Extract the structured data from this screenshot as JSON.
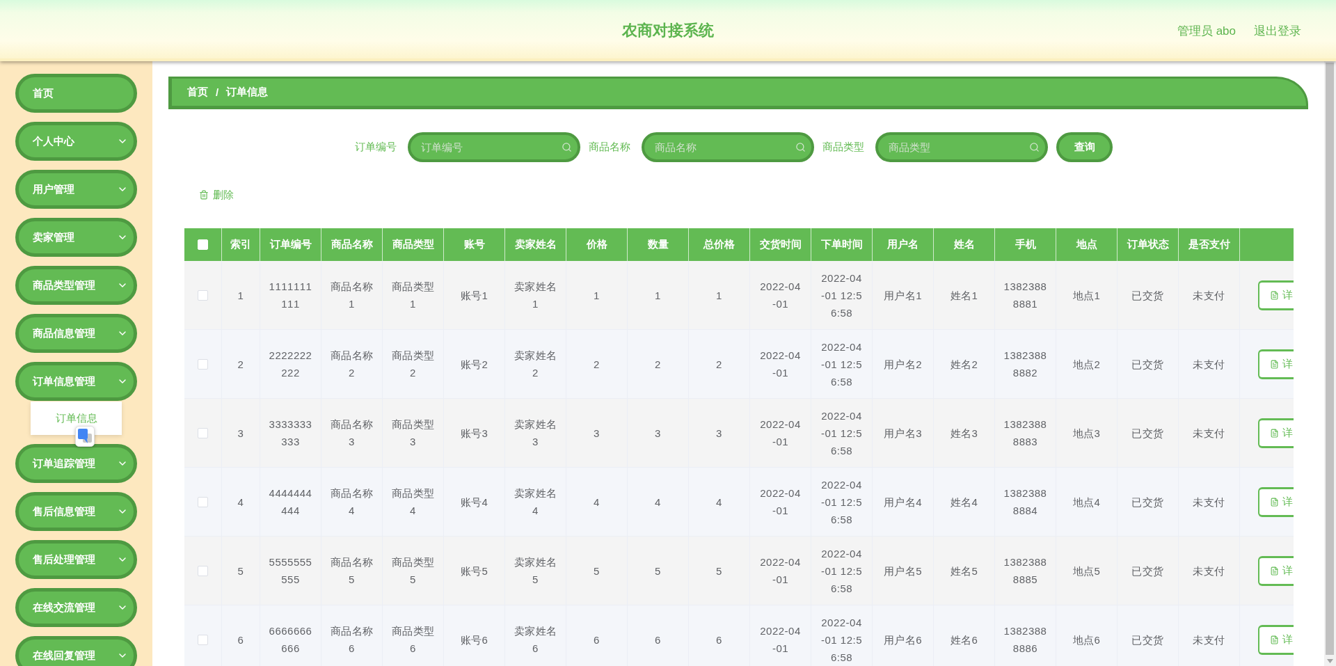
{
  "header": {
    "title": "农商对接系统",
    "user": "管理员 abo",
    "logout": "退出登录"
  },
  "sidebar": {
    "items": [
      {
        "label": "首页",
        "kind": "link"
      },
      {
        "label": "个人中心",
        "kind": "submenu"
      },
      {
        "label": "用户管理",
        "kind": "submenu"
      },
      {
        "label": "卖家管理",
        "kind": "submenu"
      },
      {
        "label": "商品类型管理",
        "kind": "submenu"
      },
      {
        "label": "商品信息管理",
        "kind": "submenu"
      },
      {
        "label": "订单信息管理",
        "kind": "submenu",
        "children": [
          {
            "label": "订单信息"
          }
        ]
      },
      {
        "label": "订单追踪管理",
        "kind": "submenu"
      },
      {
        "label": "售后信息管理",
        "kind": "submenu"
      },
      {
        "label": "售后处理管理",
        "kind": "submenu"
      },
      {
        "label": "在线交流管理",
        "kind": "submenu"
      },
      {
        "label": "在线回复管理",
        "kind": "submenu"
      }
    ]
  },
  "breadcrumb": {
    "items": [
      "首页",
      "订单信息"
    ],
    "separator": "/"
  },
  "search": {
    "fields": [
      {
        "label": "订单编号",
        "placeholder": "订单编号"
      },
      {
        "label": "商品名称",
        "placeholder": "商品名称"
      },
      {
        "label": "商品类型",
        "placeholder": "商品类型"
      }
    ],
    "button": "查询"
  },
  "toolbar": {
    "delete": "删除"
  },
  "table": {
    "select_all": {
      "checked": false
    },
    "columns": [
      "索引",
      "订单编号",
      "商品名称",
      "商品类型",
      "账号",
      "卖家姓名",
      "价格",
      "数量",
      "总价格",
      "交货时间",
      "下单时间",
      "用户名",
      "姓名",
      "手机",
      "地点",
      "订单状态",
      "是否支付"
    ],
    "rows": [
      {
        "checked": false,
        "cells": [
          "1",
          "1111111111",
          "商品名称1",
          "商品类型1",
          "账号1",
          "卖家姓名1",
          "1",
          "1",
          "1",
          "2022-04-01",
          "2022-04-01 12:56:58",
          "用户名1",
          "姓名1",
          "13823888881",
          "地点1",
          "已交货",
          "未支付"
        ],
        "action": "详"
      },
      {
        "checked": false,
        "cells": [
          "2",
          "2222222222",
          "商品名称2",
          "商品类型2",
          "账号2",
          "卖家姓名2",
          "2",
          "2",
          "2",
          "2022-04-01",
          "2022-04-01 12:56:58",
          "用户名2",
          "姓名2",
          "13823888882",
          "地点2",
          "已交货",
          "未支付"
        ],
        "action": "详"
      },
      {
        "checked": false,
        "cells": [
          "3",
          "3333333333",
          "商品名称3",
          "商品类型3",
          "账号3",
          "卖家姓名3",
          "3",
          "3",
          "3",
          "2022-04-01",
          "2022-04-01 12:56:58",
          "用户名3",
          "姓名3",
          "13823888883",
          "地点3",
          "已交货",
          "未支付"
        ],
        "action": "详"
      },
      {
        "checked": false,
        "cells": [
          "4",
          "4444444444",
          "商品名称4",
          "商品类型4",
          "账号4",
          "卖家姓名4",
          "4",
          "4",
          "4",
          "2022-04-01",
          "2022-04-01 12:56:58",
          "用户名4",
          "姓名4",
          "13823888884",
          "地点4",
          "已交货",
          "未支付"
        ],
        "action": "详"
      },
      {
        "checked": false,
        "cells": [
          "5",
          "5555555555",
          "商品名称5",
          "商品类型5",
          "账号5",
          "卖家姓名5",
          "5",
          "5",
          "5",
          "2022-04-01",
          "2022-04-01 12:56:58",
          "用户名5",
          "姓名5",
          "13823888885",
          "地点5",
          "已交货",
          "未支付"
        ],
        "action": "详"
      },
      {
        "checked": false,
        "cells": [
          "6",
          "6666666666",
          "商品名称6",
          "商品类型6",
          "账号6",
          "卖家姓名6",
          "6",
          "6",
          "6",
          "2022-04-01",
          "2022-04-01 12:56:58",
          "用户名6",
          "姓名6",
          "13823888886",
          "地点6",
          "已交货",
          "未支付"
        ],
        "action": "详"
      }
    ]
  }
}
